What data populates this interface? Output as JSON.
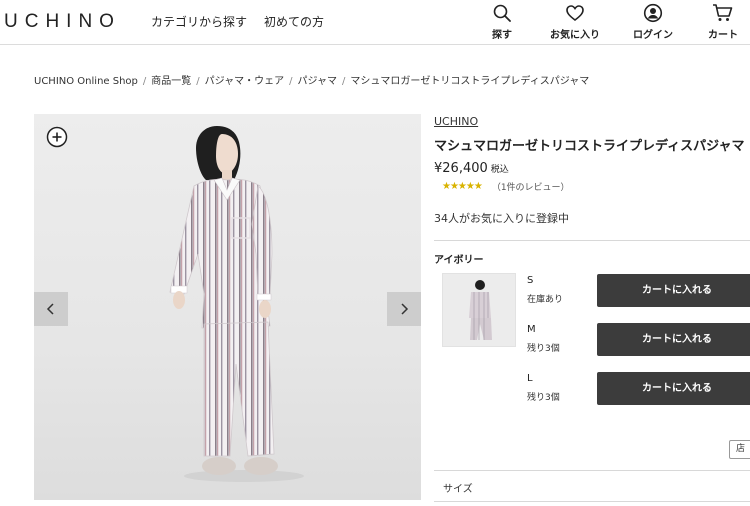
{
  "header": {
    "logo": "UCHINO",
    "nav": {
      "category": "カテゴリから探す",
      "first_time": "初めての方"
    },
    "icons": {
      "search": "探す",
      "favorite": "お気に入り",
      "login": "ログイン",
      "cart": "カート"
    }
  },
  "breadcrumb": [
    "UCHINO Online Shop",
    "商品一覧",
    "パジャマ・ウェア",
    "パジャマ",
    "マシュマロガーゼトリコストライプレディスパジャマ"
  ],
  "product": {
    "brand": "UCHINO",
    "title": "マシュマロガーゼトリコストライプレディスパジャマ",
    "price": "¥26,400",
    "tax_label": "税込",
    "rating_stars": "★★★★★",
    "rating_value": 5,
    "review_count": "（1件のレビュー）",
    "favorite_count_text": "34人がお気に入りに登録中",
    "color_label": "アイボリー",
    "sizes": [
      {
        "size": "S",
        "stock": "在庫あり",
        "button": "カートに入れる"
      },
      {
        "size": "M",
        "stock": "残り3個",
        "button": "カートに入れる"
      },
      {
        "size": "L",
        "stock": "残り3個",
        "button": "カートに入れる"
      }
    ],
    "store_button": "店",
    "size_section_label": "サイズ"
  },
  "colors": {
    "button_bg": "#3c3c3c",
    "star": "#d9b300",
    "divider": "#d8d8d8"
  },
  "icon_names": [
    "search-icon",
    "heart-icon",
    "user-icon",
    "cart-icon",
    "zoom-plus-icon",
    "chevron-left-icon",
    "chevron-right-icon"
  ]
}
